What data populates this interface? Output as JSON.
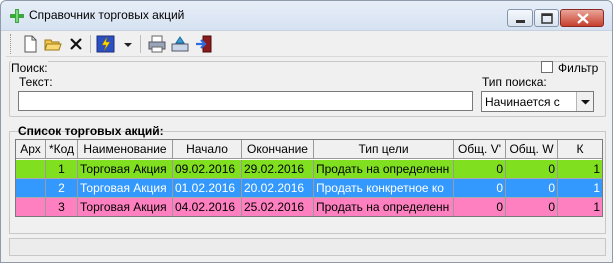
{
  "window": {
    "title": "Справочник торговых акций"
  },
  "toolbar": {
    "buttons": [
      "new-icon",
      "open-icon",
      "delete-icon",
      "action-icon",
      "print-icon",
      "export-icon",
      "exit-icon"
    ]
  },
  "search": {
    "group_label": "Поиск:",
    "filter_label": "Фильтр",
    "filter_checked": false,
    "text_label": "Текст:",
    "text_value": "",
    "type_label": "Тип поиска:",
    "type_value": "Начинается с"
  },
  "list": {
    "label": "Список торговых акций:",
    "columns": [
      "Арх",
      "*Код",
      "Наименование",
      "Начало",
      "Окончание",
      "Тип цели",
      "Общ. V'",
      "Общ. W",
      "К"
    ],
    "rows": [
      {
        "arch": "",
        "code": "1",
        "name": "Торговая Акция",
        "start": "09.02.2016",
        "end": "29.02.2016",
        "target": "Продать на определенн",
        "v": "0",
        "w": "0",
        "k": "1",
        "bg": "#80e020",
        "fg": "#000000"
      },
      {
        "arch": "",
        "code": "2",
        "name": "Торговая Акция",
        "start": "01.02.2016",
        "end": "20.02.2016",
        "target": "Продать конкретное ко",
        "v": "0",
        "w": "0",
        "k": "1",
        "bg": "#3399ff",
        "fg": "#ffffff"
      },
      {
        "arch": "",
        "code": "3",
        "name": "Торговая Акция",
        "start": "04.02.2016",
        "end": "25.02.2016",
        "target": "Продать на определенн",
        "v": "0",
        "w": "0",
        "k": "1",
        "bg": "#ff80c0",
        "fg": "#000000"
      }
    ]
  }
}
